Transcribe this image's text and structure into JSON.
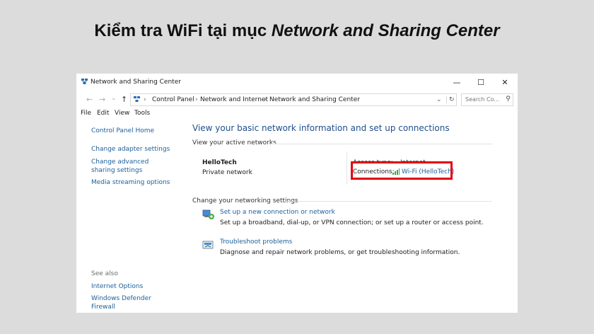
{
  "banner": {
    "title_plain": "Kiểm tra WiFi tại mục",
    "title_italic": "Network and Sharing Center"
  },
  "window": {
    "title": "Network and Sharing Center",
    "minimize_glyph": "—",
    "maximize_glyph": "☐",
    "close_glyph": "✕"
  },
  "address_bar": {
    "back_glyph": "←",
    "forward_glyph": "→",
    "recent_glyph": "⌄",
    "up_glyph": "↑",
    "sep": "›",
    "breadcrumb": [
      "Control Panel",
      "Network and Internet",
      "Network and Sharing Center"
    ],
    "dropdown_glyph": "⌄",
    "refresh_glyph": "↻",
    "search_placeholder": "Search Co...",
    "search_glyph": "⚲"
  },
  "menu": [
    "File",
    "Edit",
    "View",
    "Tools"
  ],
  "sidebar": {
    "home": "Control Panel Home",
    "links": [
      "Change adapter settings",
      "Change advanced sharing settings",
      "Media streaming options"
    ],
    "see_also": "See also",
    "see_also_links": [
      "Internet Options",
      "Windows Defender Firewall"
    ]
  },
  "main": {
    "heading": "View your basic network information and set up connections",
    "active_networks_label": "View your active networks",
    "network_name": "HelloTech",
    "network_type": "Private network",
    "access_type_label": "Access type:",
    "access_type_value": "Internet",
    "connections_label": "Connections:",
    "connection_value": "Wi-Fi (HelloTech)",
    "change_settings_label": "Change your networking settings",
    "tasks": [
      {
        "title": "Set up a new connection or network",
        "desc": "Set up a broadband, dial-up, or VPN connection; or set up a router or access point."
      },
      {
        "title": "Troubleshoot problems",
        "desc": "Diagnose and repair network problems, or get troubleshooting information."
      }
    ]
  },
  "colors": {
    "link": "#1b5f9b",
    "heading": "#1e4e8c",
    "highlight": "#e3000f",
    "wifi_bars": "#3aa84a"
  }
}
